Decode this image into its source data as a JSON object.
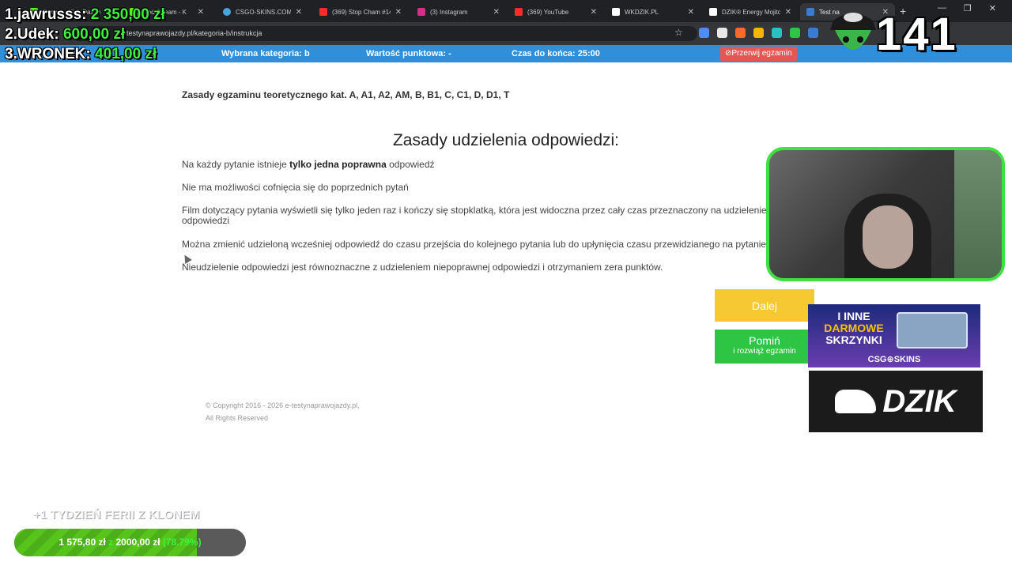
{
  "browser": {
    "tabs": [
      {
        "label": "Stream - Kick Dashb"
      },
      {
        "label": "Mod Stream - K"
      },
      {
        "label": "CSGO-SKINS.COM - "
      },
      {
        "label": "(369) Stop Cham #14"
      },
      {
        "label": "(3) Instagram"
      },
      {
        "label": "(369) YouTube"
      },
      {
        "label": "WKDZIK.PL"
      },
      {
        "label": "DZIK® Energy Mojito"
      },
      {
        "label": "Test na"
      }
    ],
    "url": "e-testynaprawojazdy.pl/kategoria-b/instrukcja",
    "win_controls": [
      "—",
      "❐",
      "✕"
    ],
    "newtab": "+"
  },
  "exam_bar": {
    "category": "Wybrana kategoria: b",
    "points": "Wartość punktowa: -",
    "time": "Czas do końca: 25:00",
    "stop_button": "Przerwij egzamin"
  },
  "leaderboard": [
    {
      "rank": "1.",
      "name": "jawrusss:",
      "amount": "2 350,00 zł"
    },
    {
      "rank": "2.",
      "name": "Udek:",
      "amount": "600,00 zł"
    },
    {
      "rank": "3.",
      "name": "WRONEK:",
      "amount": "401,00 zł"
    }
  ],
  "page": {
    "heading_small": "Zasady egzaminu teoretycznego kat. A, A1, A2, AM, B, B1, C, C1, D, D1, T",
    "heading_main": "Zasady udzielenia odpowiedzi:",
    "rule1_pre": "Na każdy pytanie istnieje ",
    "rule1_bold": "tylko jedna poprawna",
    "rule1_post": " odpowiedź",
    "rule2": "Nie ma możliwości cofnięcia się do poprzednich pytań",
    "rule3": "Film dotyczący pytania wyświetli się tylko jeden raz i kończy się stopklatką, która jest widoczna przez cały czas przeznaczony na udzielenie odpowiedzi",
    "rule4": "Można zmienić udzieloną wcześniej odpowiedź do czasu przejścia do kolejnego pytania lub do upłynięcia czasu przewidzianego na pytanie",
    "rule5": "Nieudzielenie odpowiedzi jest równoznaczne z udzieleniem niepoprawnej odpowiedzi i otrzymaniem zera punktów.",
    "next_button": "Dalej",
    "skip_line1": "Pomiń",
    "skip_line2": "i rozwiąż egzamin",
    "copyright_line1": "© Copyright 2016 - 2026 e-testynaprawojazdy.pl,",
    "copyright_line2": "All Rights Reserved"
  },
  "overlay": {
    "counter": "141",
    "ad_boxes_line1": "I INNE",
    "ad_boxes_line2": "DARMOWE",
    "ad_boxes_line3": "SKRZYNKI",
    "ad_boxes_brand": "CSG⊕SKINS",
    "ad_dzik_brand": "DZIK",
    "goal_caption": "+1 TYDZIEŃ FERII Z KLONEM",
    "goal_current": "1 575,80 zł",
    "goal_sep": "z",
    "goal_target": "2000,00 zł",
    "goal_percent": "(78.79%)",
    "goal_fraction": 0.7879
  },
  "colors": {
    "exam_bar": "#2f8fdb",
    "next_button": "#f6c932",
    "skip_button": "#2ec545",
    "stop_button": "#e35757",
    "leaderboard_amount": "#3cf23c",
    "cam_border": "#3fe03f"
  }
}
